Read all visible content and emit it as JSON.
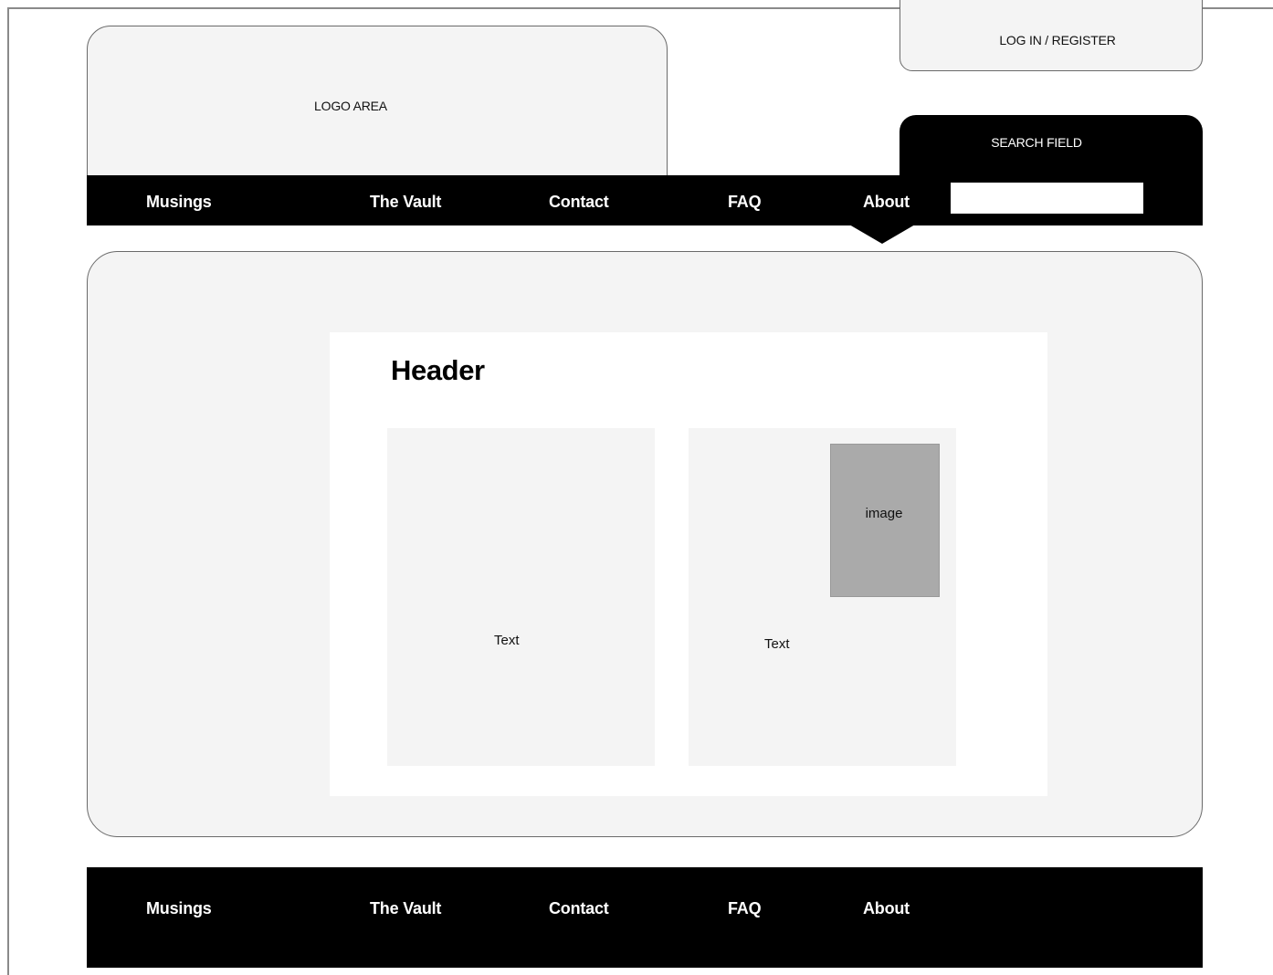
{
  "header": {
    "logo_label": "LOGO AREA",
    "login_label": "LOG IN / REGISTER",
    "search_label": "SEARCH FIELD",
    "search_value": ""
  },
  "nav": {
    "items": [
      "Musings",
      "The Vault",
      "Contact",
      "FAQ",
      "About"
    ],
    "active": "About"
  },
  "content": {
    "header": "Header",
    "left_text": "Text",
    "right_text": "Text",
    "image_label": "image"
  },
  "footer": {
    "items": [
      "Musings",
      "The Vault",
      "Contact",
      "FAQ",
      "About"
    ]
  },
  "colors": {
    "bar": "#000000",
    "panel": "#f4f4f4",
    "image_placeholder": "#aaaaaa"
  }
}
